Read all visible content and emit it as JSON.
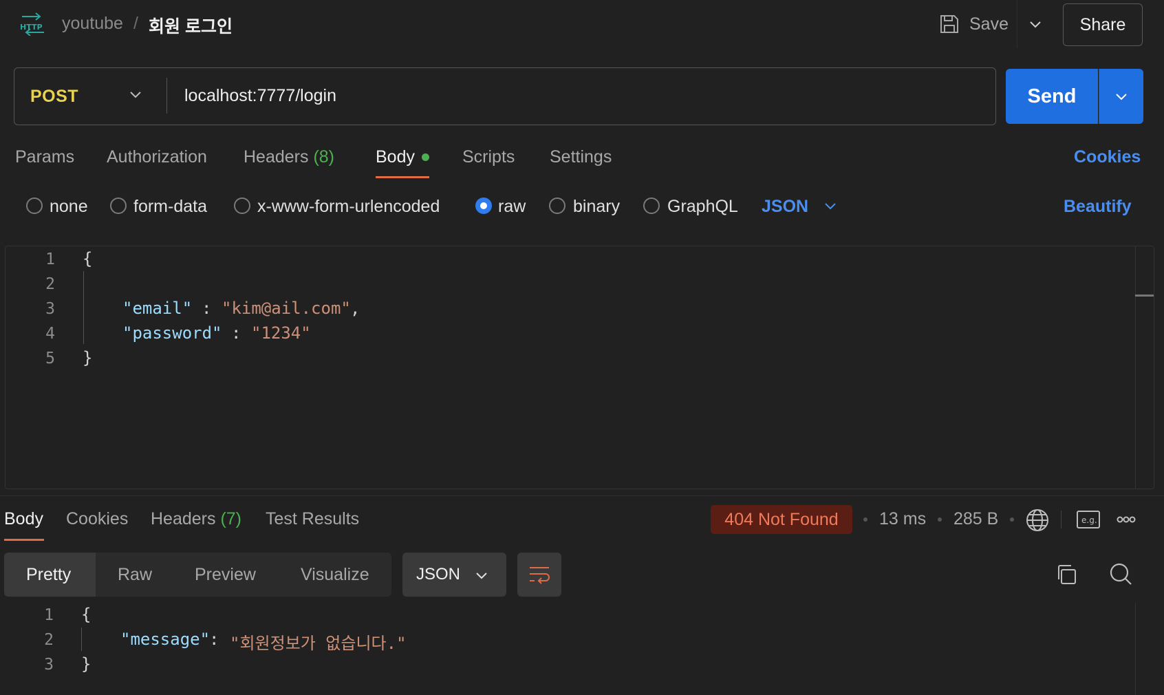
{
  "header": {
    "collection": "youtube",
    "separator": "/",
    "request_name": "회원 로그인",
    "save_label": "Save",
    "share_label": "Share",
    "protocol_icon": "http-icon"
  },
  "request": {
    "method": "POST",
    "url": "localhost:7777/login",
    "send_label": "Send"
  },
  "request_tabs": {
    "params": "Params",
    "authorization": "Authorization",
    "headers": "Headers",
    "headers_count": "(8)",
    "body": "Body",
    "scripts": "Scripts",
    "settings": "Settings",
    "cookies": "Cookies",
    "active": "Body"
  },
  "body_types": {
    "none": "none",
    "form_data": "form-data",
    "urlencoded": "x-www-form-urlencoded",
    "raw": "raw",
    "binary": "binary",
    "graphql": "GraphQL",
    "selected": "raw",
    "format": "JSON",
    "beautify": "Beautify"
  },
  "request_body": {
    "line_numbers": [
      "1",
      "2",
      "3",
      "4",
      "5"
    ],
    "open_brace": "{",
    "close_brace": "}",
    "email_key": "\"email\"",
    "email_value": "\"kim@ail.com\"",
    "password_key": "\"password\"",
    "password_value": "\"1234\"",
    "colon": ":",
    "comma": ","
  },
  "response_tabs": {
    "body": "Body",
    "cookies": "Cookies",
    "headers": "Headers",
    "headers_count": "(7)",
    "test_results": "Test Results",
    "active": "Body"
  },
  "response_meta": {
    "status": "404 Not Found",
    "time": "13 ms",
    "size": "285 B",
    "status_color": "#f07a5a"
  },
  "response_view": {
    "pretty": "Pretty",
    "raw": "Raw",
    "preview": "Preview",
    "visualize": "Visualize",
    "format": "JSON",
    "active": "Pretty"
  },
  "response_body": {
    "line_numbers": [
      "1",
      "2",
      "3"
    ],
    "open_brace": "{",
    "close_brace": "}",
    "message_key": "\"message\"",
    "message_value": "\"회원정보가 없습니다.\"",
    "colon": ":"
  },
  "colors": {
    "accent_orange": "#e06c46",
    "primary_blue": "#1f6fe0",
    "link_blue": "#4a8ef0",
    "method_yellow": "#e9d24e",
    "success_green": "#4caf50"
  }
}
